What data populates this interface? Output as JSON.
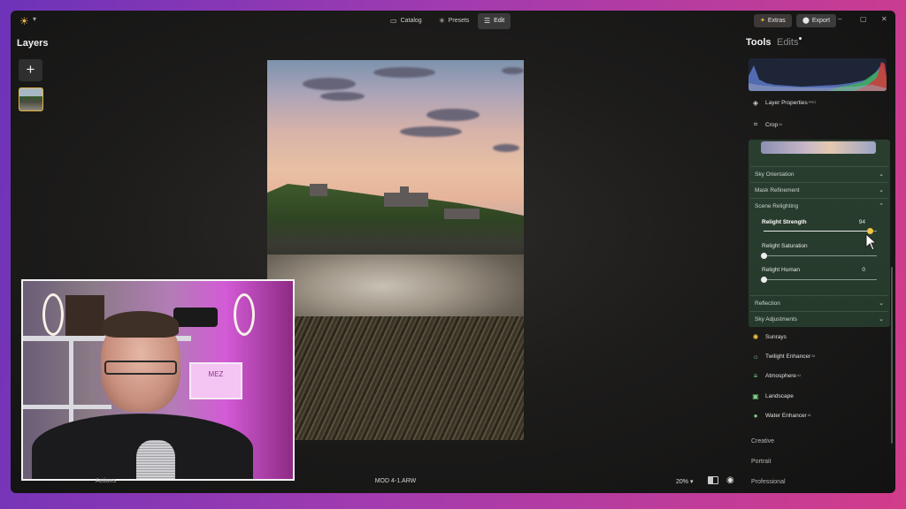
{
  "topbar": {
    "tabs": [
      {
        "label": "Catalog",
        "icon": "folder-icon"
      },
      {
        "label": "Presets",
        "icon": "sparkle-icon"
      },
      {
        "label": "Edit",
        "icon": "sliders-icon"
      }
    ],
    "active_tab": "Edit",
    "extras_label": "Extras",
    "export_label": "Export"
  },
  "layers": {
    "title": "Layers",
    "add_label": "+"
  },
  "canvas": {
    "filename": "MOD 4-1.ARW",
    "zoom": "20%",
    "actions_label": "Actions"
  },
  "webcam": {
    "sign_text": "MEZ"
  },
  "panel": {
    "tabs": {
      "tools": "Tools",
      "edits": "Edits"
    },
    "tool_rows_top": [
      {
        "label": "Layer Properties",
        "badge": "PRO",
        "icon": "layers-icon"
      },
      {
        "label": "Crop",
        "badge": "AI",
        "icon": "crop-icon"
      }
    ],
    "sky_sections": [
      {
        "label": "Sky Orientation",
        "expanded": false
      },
      {
        "label": "Mask Refinement",
        "expanded": false
      },
      {
        "label": "Scene Relighting",
        "expanded": true
      }
    ],
    "sliders": [
      {
        "label": "Relight Strength",
        "value": "94",
        "fraction": 0.94,
        "active": true
      },
      {
        "label": "Relight Saturation",
        "value": "",
        "fraction": 0.0,
        "active": false
      },
      {
        "label": "Relight Human",
        "value": "0",
        "fraction": 0.0,
        "active": false
      }
    ],
    "sky_sections_bottom": [
      {
        "label": "Reflection"
      },
      {
        "label": "Sky Adjustments"
      }
    ],
    "tools": [
      {
        "label": "Sunrays",
        "badge": "",
        "icon": "sun-icon"
      },
      {
        "label": "Twilight Enhancer",
        "badge": "AI",
        "icon": "twilight-icon"
      },
      {
        "label": "Atmosphere",
        "badge": "AI",
        "icon": "atmosphere-icon"
      },
      {
        "label": "Landscape",
        "badge": "",
        "icon": "landscape-icon"
      },
      {
        "label": "Water Enhancer",
        "badge": "AI",
        "icon": "droplet-icon"
      }
    ],
    "categories": [
      "Creative",
      "Portrait",
      "Professional"
    ]
  },
  "colors": {
    "accent": "#f2c440",
    "panel_green": "#263a2c",
    "background": "#1d1c1b"
  }
}
